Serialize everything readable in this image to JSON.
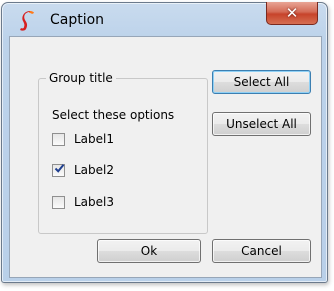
{
  "window": {
    "title": "Caption",
    "close_symbol": "✕"
  },
  "icons": {
    "app": "app-logo-icon",
    "close": "close-icon",
    "check": "checkmark-icon"
  },
  "group": {
    "title": "Group title",
    "description": "Select these options",
    "options": [
      {
        "label": "Label1",
        "checked": false
      },
      {
        "label": "Label2",
        "checked": true
      },
      {
        "label": "Label3",
        "checked": false
      }
    ]
  },
  "buttons": {
    "select_all": "Select All",
    "unselect_all": "Unselect All",
    "ok": "Ok",
    "cancel": "Cancel"
  },
  "colors": {
    "titlebar": "#bcd2ea",
    "close_button": "#c7432b",
    "app_icon": "#d71f1f",
    "checkmark": "#1f3f8f"
  }
}
